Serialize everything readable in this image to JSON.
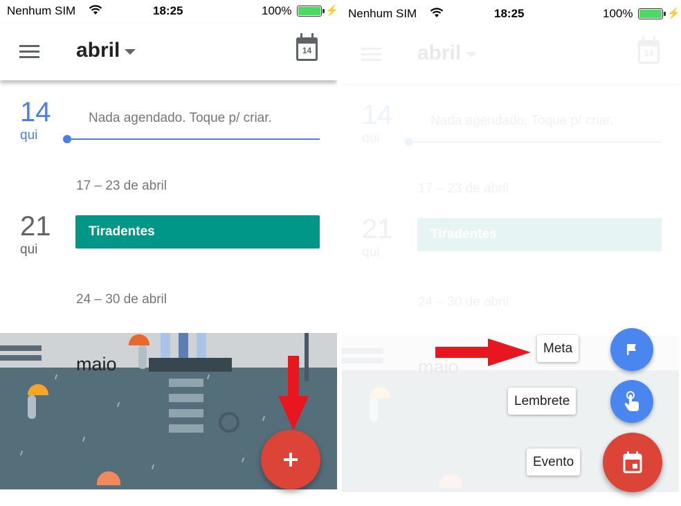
{
  "status": {
    "carrier": "Nenhum SIM",
    "time": "18:25",
    "battery": "100%"
  },
  "appbar": {
    "month": "abril",
    "today_day": "14",
    "menu_icon": "hamburger-menu-icon",
    "today_icon": "calendar-today-icon"
  },
  "schedule": {
    "today": {
      "day": "14",
      "weekday": "qui",
      "empty_text": "Nada agendado. Toque p/ criar."
    },
    "week1": "17 – 23 de abril",
    "event_day": {
      "day": "21",
      "weekday": "qui",
      "title": "Tiradentes"
    },
    "week2": "24 – 30 de abril",
    "next_month": "maio"
  },
  "fab": {
    "icon": "plus-icon"
  },
  "speed_dial": [
    {
      "label": "Meta",
      "icon": "flag-icon"
    },
    {
      "label": "Lembrete",
      "icon": "reminder-hand-icon"
    },
    {
      "label": "Evento",
      "icon": "calendar-event-icon"
    }
  ],
  "colors": {
    "accent_blue": "#4a7ee8",
    "event_teal": "#009688",
    "fab_red": "#db4437",
    "mini_fab_blue": "#4a86f0",
    "annotation_red": "#e8161f"
  }
}
